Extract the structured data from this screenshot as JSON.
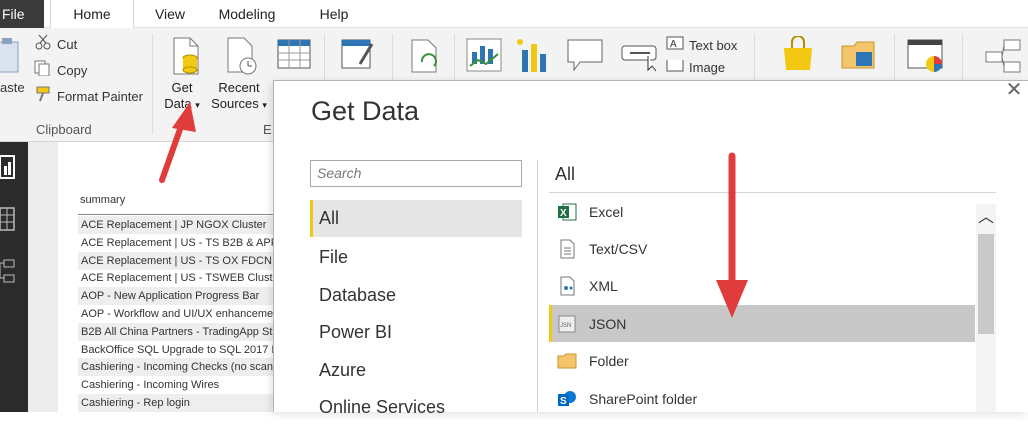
{
  "menu": {
    "file": "File",
    "tabs": [
      "Home",
      "View",
      "Modeling",
      "Help"
    ]
  },
  "ribbon": {
    "paste": "aste",
    "cut": "Cut",
    "copy": "Copy",
    "format_painter": "Format Painter",
    "clipboard_group": "Clipboard",
    "get_data_line1": "Get",
    "get_data_line2": "Data",
    "recent_line1": "Recent",
    "recent_line2": "Sources",
    "external_group_partial": "E",
    "text_box": "Text box",
    "image": "Image"
  },
  "table": {
    "header": "summary",
    "rows": [
      "ACE Replacement | JP NGOX Cluster",
      "ACE Replacement | US - TS B2B & APP",
      "ACE Replacement | US - TS OX  FDCN C",
      "ACE Replacement | US - TSWEB Cluster",
      "AOP - New Application Progress Bar",
      "AOP - Workflow and UI/UX enhanceme",
      "B2B All China Partners - TradingApp St",
      "BackOffice SQL Upgrade to SQL 2017 I",
      "Cashiering - Incoming Checks (no scan",
      "Cashiering - Incoming Wires",
      "Cashiering - Rep login"
    ]
  },
  "dialog": {
    "title": "Get Data",
    "close": "✕",
    "search_placeholder": "Search",
    "categories": [
      "All",
      "File",
      "Database",
      "Power BI",
      "Azure",
      "Online Services"
    ],
    "selected_category": "All",
    "right_title": "All",
    "items": [
      {
        "label": "Excel",
        "icon": "excel-icon"
      },
      {
        "label": "Text/CSV",
        "icon": "text-csv-icon"
      },
      {
        "label": "XML",
        "icon": "xml-icon"
      },
      {
        "label": "JSON",
        "icon": "json-icon"
      },
      {
        "label": "Folder",
        "icon": "folder-icon"
      },
      {
        "label": "SharePoint folder",
        "icon": "sharepoint-folder-icon"
      }
    ],
    "selected_item": "JSON"
  },
  "colors": {
    "accent_yellow": "#f2c811",
    "arrow_red": "#e03c3c",
    "excel_green": "#1e7145",
    "sharepoint_blue": "#0f78d4"
  }
}
